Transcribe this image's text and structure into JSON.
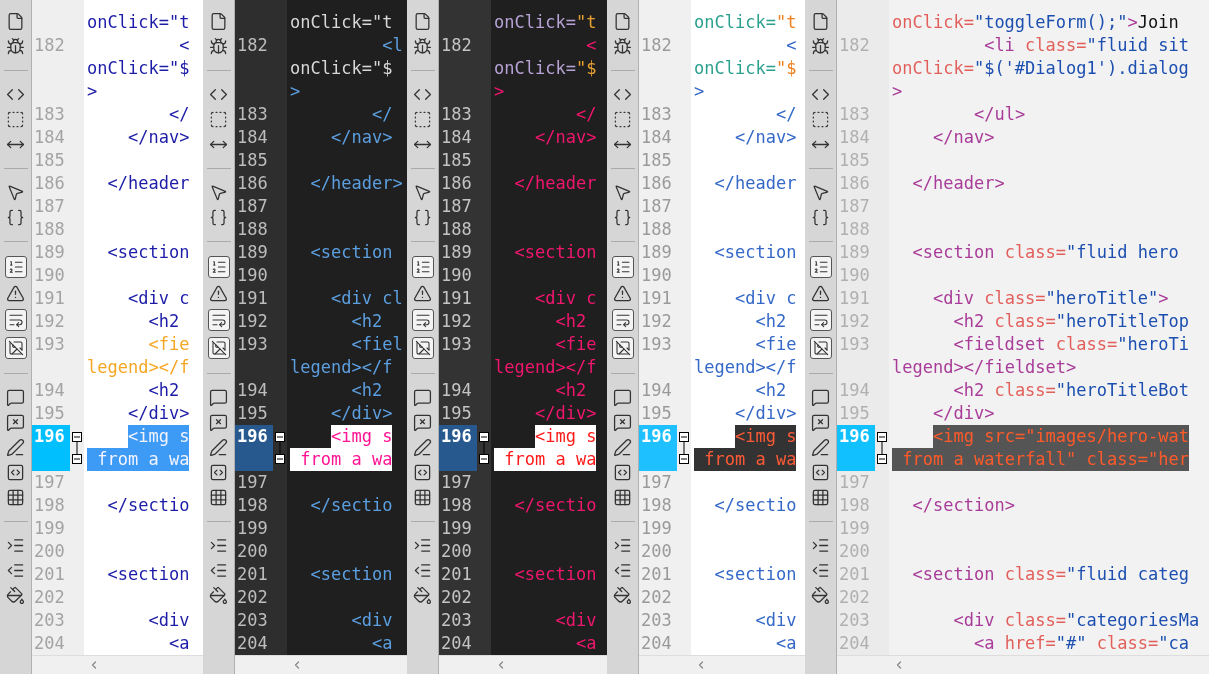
{
  "panes": [
    {
      "kind": "light",
      "lines": [
        {
          "code": "onClick=\"t",
          "selected": false,
          "flagged": false
        },
        {
          "n": "182",
          "code": "         <",
          "selected": false,
          "flagged": false
        },
        {
          "code": "onClick=\"$",
          "selected": false,
          "flagged": false
        },
        {
          "code": ">",
          "selected": false,
          "flagged": false
        },
        {
          "n": "183",
          "code": "        </",
          "selected": false,
          "flagged": false
        },
        {
          "n": "184",
          "code": "    </nav>",
          "selected": false,
          "flagged": false
        },
        {
          "n": "185",
          "selected": false
        },
        {
          "n": "186",
          "code": "  </header",
          "selected": false,
          "flagged": false
        },
        {
          "n": "187",
          "selected": false
        },
        {
          "n": "188",
          "selected": false
        },
        {
          "n": "189",
          "code": "  <section",
          "selected": false,
          "flagged": false
        },
        {
          "n": "190",
          "selected": false
        },
        {
          "n": "191",
          "code": "    <div c",
          "selected": false,
          "flagged": false
        },
        {
          "n": "192",
          "code": "      <h2",
          "selected": false,
          "flagged": false
        },
        {
          "n": "193",
          "code": "      <fie",
          "selected": false,
          "flagged": true
        },
        {
          "code": "legend></f",
          "selected": false,
          "flagged": true
        },
        {
          "n": "194",
          "code": "      <h2",
          "selected": false,
          "flagged": false
        },
        {
          "n": "195",
          "code": "    </div>",
          "selected": false,
          "flagged": false
        },
        {
          "n": "196",
          "code": "    <img s",
          "selected": true,
          "flagged": false
        },
        {
          "code": " from a wa",
          "selected": true,
          "flagged": false
        },
        {
          "n": "197",
          "selected": false
        },
        {
          "n": "198",
          "code": "  </sectio",
          "selected": false,
          "flagged": false
        },
        {
          "n": "199",
          "selected": false
        },
        {
          "n": "200",
          "selected": false
        },
        {
          "n": "201",
          "code": "  <section",
          "selected": false,
          "flagged": false
        },
        {
          "n": "202",
          "selected": false
        },
        {
          "n": "203",
          "code": "      <div",
          "selected": false,
          "flagged": false
        },
        {
          "n": "204",
          "code": "        <a",
          "selected": false,
          "flagged": false
        }
      ]
    },
    {
      "kind": "dark",
      "lines": [
        {
          "code": "onClick=\"t",
          "selected": false
        },
        {
          "n": "182",
          "code": "         <l",
          "selected": false
        },
        {
          "code": "onClick=\"$",
          "selected": false
        },
        {
          "code": ">",
          "selected": false
        },
        {
          "n": "183",
          "code": "        </",
          "selected": false
        },
        {
          "n": "184",
          "code": "    </nav>",
          "selected": false
        },
        {
          "n": "185",
          "selected": false
        },
        {
          "n": "186",
          "code": "  </header>",
          "selected": false
        },
        {
          "n": "187",
          "selected": false
        },
        {
          "n": "188",
          "selected": false
        },
        {
          "n": "189",
          "code": "  <section",
          "selected": false
        },
        {
          "n": "190",
          "selected": false
        },
        {
          "n": "191",
          "code": "    <div cl",
          "selected": false
        },
        {
          "n": "192",
          "code": "      <h2",
          "selected": false
        },
        {
          "n": "193",
          "code": "      <fiel",
          "selected": false
        },
        {
          "code": "legend></f",
          "selected": false
        },
        {
          "n": "194",
          "code": "      <h2",
          "selected": false
        },
        {
          "n": "195",
          "code": "    </div>",
          "selected": false
        },
        {
          "n": "196",
          "code": "    <img s",
          "selected": true
        },
        {
          "code": " from a wa",
          "selected": true
        },
        {
          "n": "197",
          "selected": false
        },
        {
          "n": "198",
          "code": "  </sectio",
          "selected": false
        },
        {
          "n": "199",
          "selected": false
        },
        {
          "n": "200",
          "selected": false
        },
        {
          "n": "201",
          "code": "  <section",
          "selected": false
        },
        {
          "n": "202",
          "selected": false
        },
        {
          "n": "203",
          "code": "      <div",
          "selected": false
        },
        {
          "n": "204",
          "code": "        <a",
          "selected": false
        }
      ]
    },
    {
      "kind": "monokai",
      "lines": [
        {
          "code": "onClick=\"t",
          "selected": false
        },
        {
          "n": "182",
          "code": "         <",
          "selected": false
        },
        {
          "code": "onClick=\"$",
          "selected": false
        },
        {
          "code": ">",
          "selected": false
        },
        {
          "n": "183",
          "code": "        </",
          "selected": false
        },
        {
          "n": "184",
          "code": "    </nav>",
          "selected": false
        },
        {
          "n": "185",
          "selected": false
        },
        {
          "n": "186",
          "code": "  </header",
          "selected": false
        },
        {
          "n": "187",
          "selected": false
        },
        {
          "n": "188",
          "selected": false
        },
        {
          "n": "189",
          "code": "  <section",
          "selected": false
        },
        {
          "n": "190",
          "selected": false
        },
        {
          "n": "191",
          "code": "    <div c",
          "selected": false
        },
        {
          "n": "192",
          "code": "      <h2",
          "selected": false
        },
        {
          "n": "193",
          "code": "      <fie",
          "selected": false
        },
        {
          "code": "legend></f",
          "selected": false
        },
        {
          "n": "194",
          "code": "      <h2",
          "selected": false
        },
        {
          "n": "195",
          "code": "    </div>",
          "selected": false
        },
        {
          "n": "196",
          "code": "    <img s",
          "selected": true
        },
        {
          "code": " from a wa",
          "selected": true
        },
        {
          "n": "197",
          "selected": false
        },
        {
          "n": "198",
          "code": "  </sectio",
          "selected": false
        },
        {
          "n": "199",
          "selected": false
        },
        {
          "n": "200",
          "selected": false
        },
        {
          "n": "201",
          "code": "  <section",
          "selected": false
        },
        {
          "n": "202",
          "selected": false
        },
        {
          "n": "203",
          "code": "      <div",
          "selected": false
        },
        {
          "n": "204",
          "code": "        <a",
          "selected": false
        }
      ]
    },
    {
      "kind": "light_alt",
      "lines": [
        {
          "code": "onClick=\"t",
          "selected": false
        },
        {
          "n": "182",
          "code": "         <",
          "selected": false
        },
        {
          "code": "onClick=\"$",
          "selected": false
        },
        {
          "code": ">",
          "selected": false
        },
        {
          "n": "183",
          "code": "        </",
          "selected": false
        },
        {
          "n": "184",
          "code": "    </nav>",
          "selected": false
        },
        {
          "n": "185",
          "selected": false
        },
        {
          "n": "186",
          "code": "  </header",
          "selected": false
        },
        {
          "n": "187",
          "selected": false
        },
        {
          "n": "188",
          "selected": false
        },
        {
          "n": "189",
          "code": "  <section",
          "selected": false
        },
        {
          "n": "190",
          "selected": false
        },
        {
          "n": "191",
          "code": "    <div c",
          "selected": false
        },
        {
          "n": "192",
          "code": "      <h2",
          "selected": false
        },
        {
          "n": "193",
          "code": "      <fie",
          "selected": false
        },
        {
          "code": "legend></f",
          "selected": false
        },
        {
          "n": "194",
          "code": "      <h2",
          "selected": false
        },
        {
          "n": "195",
          "code": "    </div>",
          "selected": false
        },
        {
          "n": "196",
          "code": "    <img s",
          "selected": true
        },
        {
          "code": " from a wa",
          "selected": true
        },
        {
          "n": "197",
          "selected": false
        },
        {
          "n": "198",
          "code": "  </sectio",
          "selected": false
        },
        {
          "n": "199",
          "selected": false
        },
        {
          "n": "200",
          "selected": false
        },
        {
          "n": "201",
          "code": "  <section",
          "selected": false
        },
        {
          "n": "202",
          "selected": false
        },
        {
          "n": "203",
          "code": "      <div",
          "selected": false
        },
        {
          "n": "204",
          "code": "        <a",
          "selected": false
        }
      ]
    },
    {
      "kind": "gray",
      "lines": [
        {
          "code": "onClick=\"toggleForm();\">Join",
          "selected": false
        },
        {
          "n": "182",
          "code": "         <li class=\"fluid sit",
          "selected": false
        },
        {
          "code": "onClick=\"$('#Dialog1').dialog",
          "selected": false
        },
        {
          "code": ">",
          "selected": false
        },
        {
          "n": "183",
          "code": "        </ul>",
          "selected": false
        },
        {
          "n": "184",
          "code": "    </nav>",
          "selected": false
        },
        {
          "n": "185",
          "selected": false
        },
        {
          "n": "186",
          "code": "  </header>",
          "selected": false
        },
        {
          "n": "187",
          "selected": false
        },
        {
          "n": "188",
          "selected": false
        },
        {
          "n": "189",
          "code": "  <section class=\"fluid hero",
          "selected": false
        },
        {
          "n": "190",
          "selected": false
        },
        {
          "n": "191",
          "code": "    <div class=\"heroTitle\">",
          "selected": false
        },
        {
          "n": "192",
          "code": "      <h2 class=\"heroTitleTop",
          "selected": false
        },
        {
          "n": "193",
          "code": "      <fieldset class=\"heroTi",
          "selected": false
        },
        {
          "code": "legend></fieldset>",
          "selected": false
        },
        {
          "n": "194",
          "code": "      <h2 class=\"heroTitleBot",
          "selected": false
        },
        {
          "n": "195",
          "code": "    </div>",
          "selected": false
        },
        {
          "n": "196",
          "code": "    <img src=\"images/hero-wat",
          "selected": true
        },
        {
          "code": " from a waterfall\" class=\"her",
          "selected": true
        },
        {
          "n": "197",
          "selected": false
        },
        {
          "n": "198",
          "code": "  </section>",
          "selected": false
        },
        {
          "n": "199",
          "selected": false
        },
        {
          "n": "200",
          "selected": false
        },
        {
          "n": "201",
          "code": "  <section class=\"fluid categ",
          "selected": false
        },
        {
          "n": "202",
          "selected": false
        },
        {
          "n": "203",
          "code": "      <div class=\"categoriesMa",
          "selected": false
        },
        {
          "n": "204",
          "code": "        <a href=\"#\" class=\"ca",
          "selected": false
        }
      ]
    }
  ]
}
